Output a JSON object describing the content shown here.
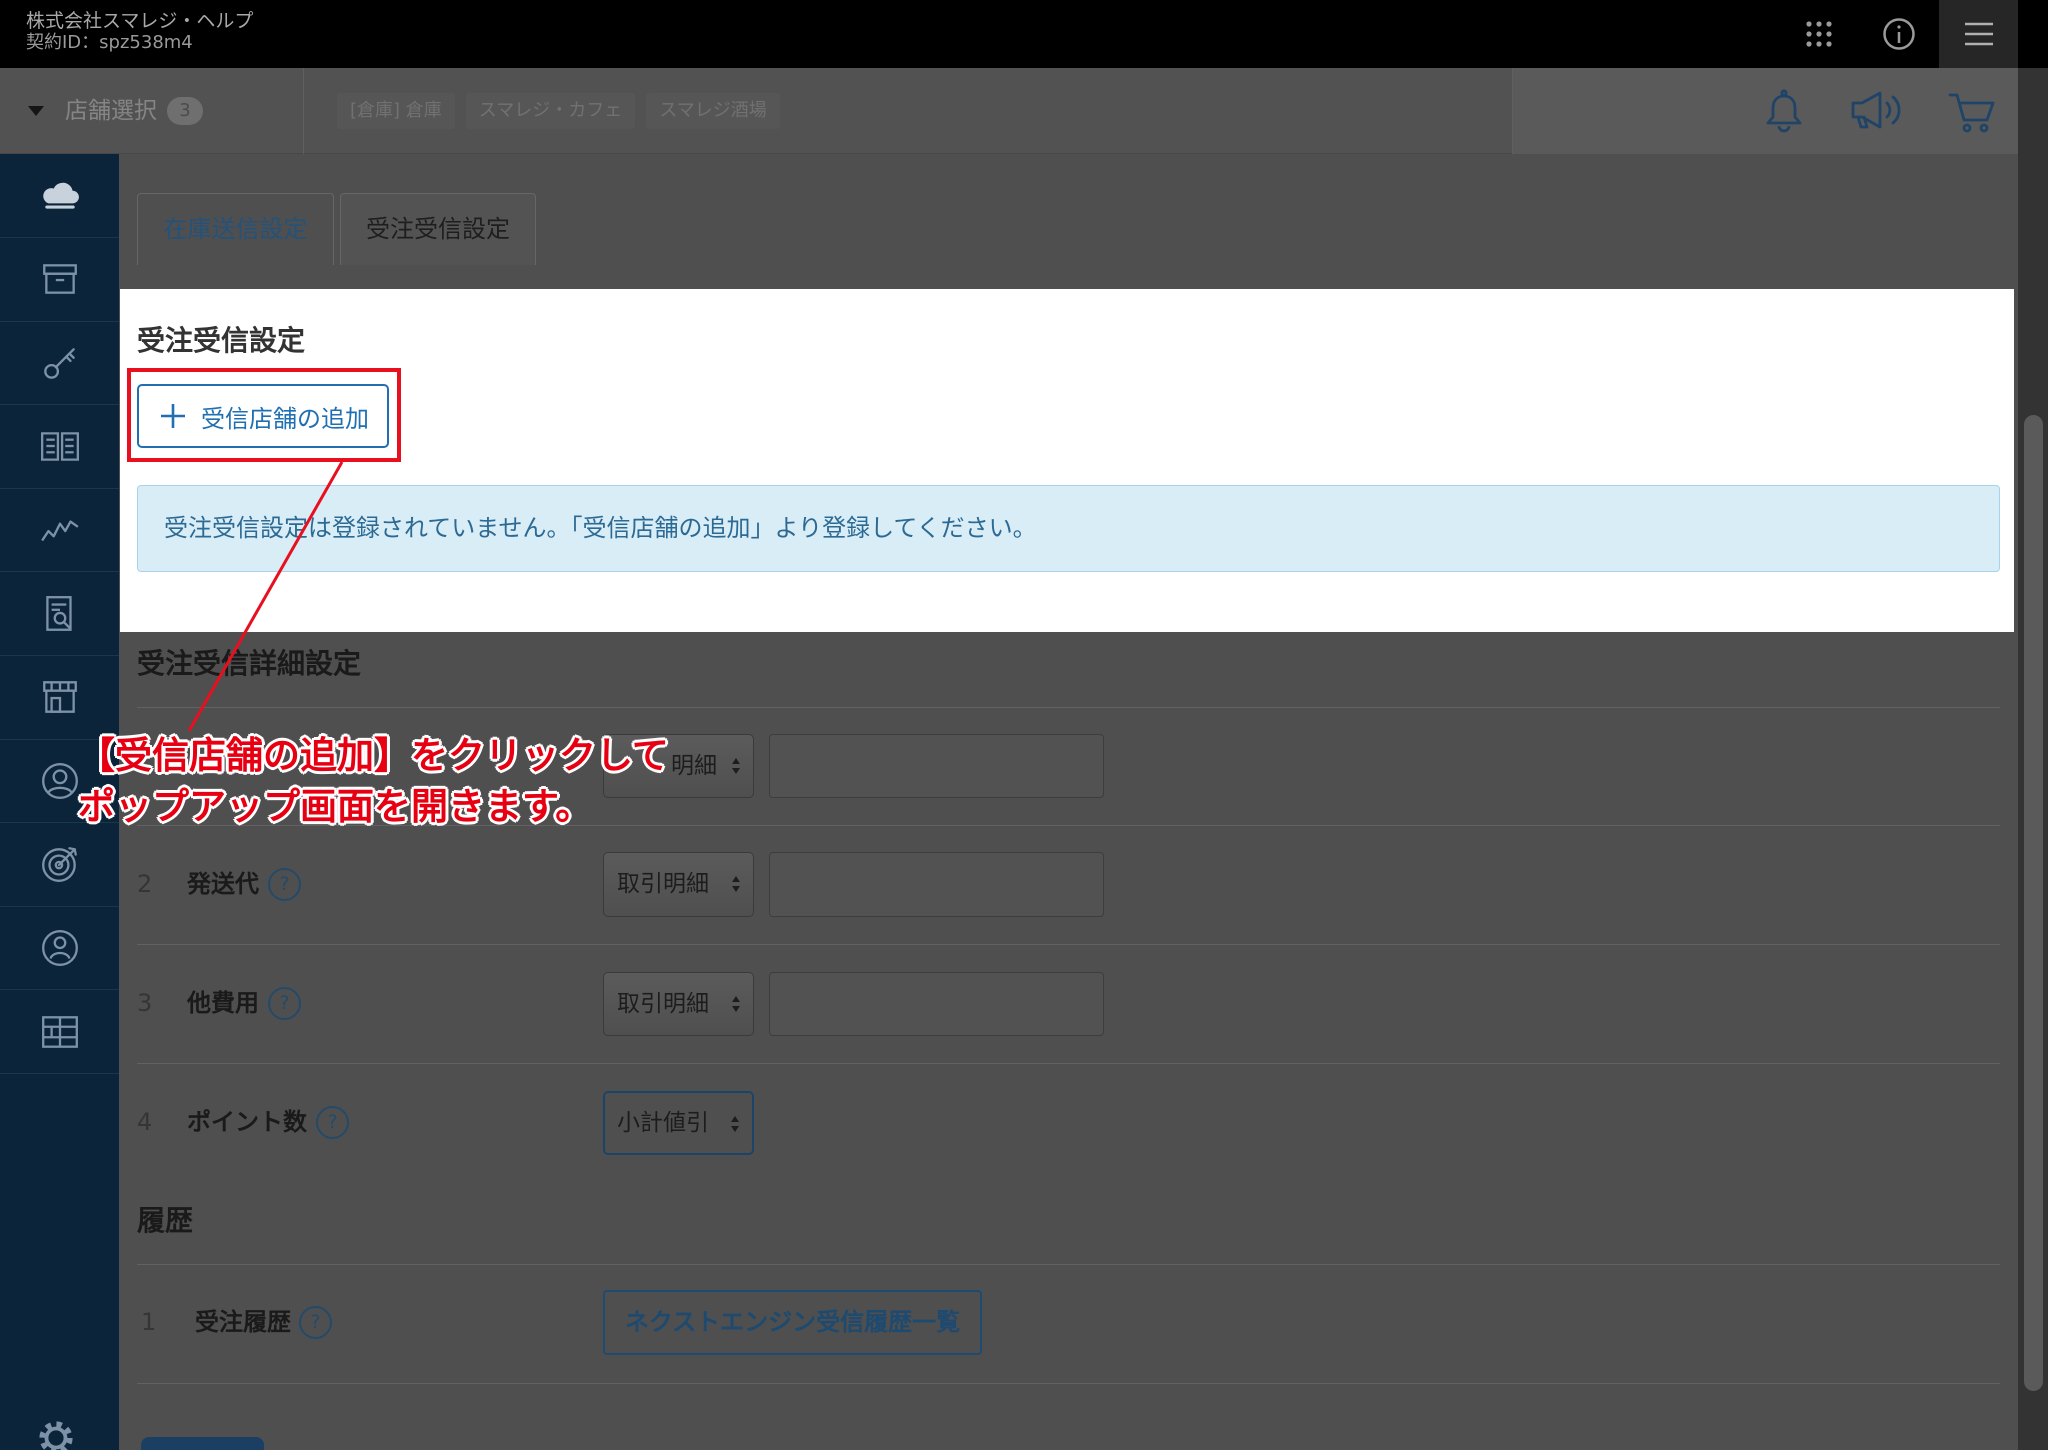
{
  "header": {
    "company": "株式会社スマレジ・ヘルプ",
    "contract_id": "契約ID：spz538m4"
  },
  "store_bar": {
    "label": "店舗選択",
    "count": "3",
    "stores": [
      "[倉庫] 倉庫",
      "スマレジ・カフェ",
      "スマレジ酒場"
    ]
  },
  "icons": {
    "header": [
      "apps-grid-icon",
      "info-icon",
      "menu-icon"
    ],
    "store_bar": [
      "caret-down-icon",
      "bell-icon",
      "megaphone-icon",
      "cart-icon"
    ],
    "sidebar": [
      "cloud-icon",
      "archive-box-icon",
      "key-icon",
      "book-icon",
      "line-chart-icon",
      "report-icon",
      "store-icon",
      "user-circle-icon",
      "target-icon",
      "person-icon",
      "grid-icon",
      "gear-icon"
    ]
  },
  "tabs": [
    {
      "label": "在庫送信設定",
      "active": false
    },
    {
      "label": "受注受信設定",
      "active": true
    }
  ],
  "receive_settings": {
    "title": "受注受信設定",
    "add_button": "受信店舗の追加",
    "empty_message": "受注受信設定は登録されていません。「受信店舗の追加」より登録してください。"
  },
  "detail_settings": {
    "title": "受注受信詳細設定",
    "rows": [
      {
        "select": "明細"
      },
      {
        "no": "2",
        "label": "発送代",
        "select": "取引明細"
      },
      {
        "no": "3",
        "label": "他費用",
        "select": "取引明細"
      },
      {
        "no": "4",
        "label": "ポイント数",
        "select": "小計値引"
      }
    ]
  },
  "history": {
    "title": "履歴",
    "rows": [
      {
        "no": "1",
        "label": "受注履歴",
        "button": "ネクストエンジン受信履歴一覧"
      }
    ]
  },
  "help_symbol": "?",
  "annotation": {
    "lines": [
      "【受信店舗の追加】をクリックして",
      "ポップアップ画面を開きます。"
    ]
  },
  "colors": {
    "accent_blue": "#1f6fb2",
    "annotation_red": "#e60012",
    "alert_bg": "#d9edf7",
    "topbar_bg": "#000000",
    "sidebar_bg": "#0c2439"
  }
}
